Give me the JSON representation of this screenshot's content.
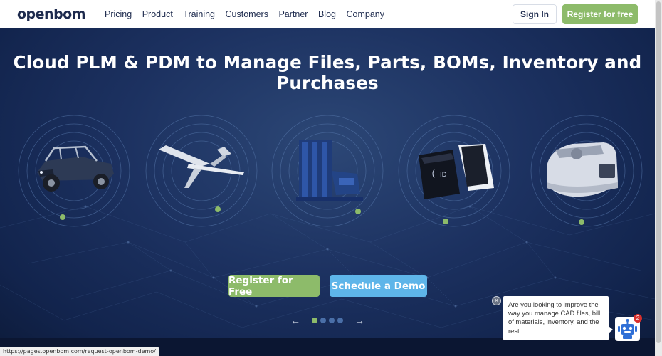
{
  "nav": {
    "logo": "openbom",
    "links": [
      "Pricing",
      "Product",
      "Training",
      "Customers",
      "Partner",
      "Blog",
      "Company"
    ],
    "sign_in": "Sign In",
    "register": "Register for free"
  },
  "hero": {
    "title": "Cloud PLM & PDM to Manage Files, Parts, BOMs, Inventory and Purchases",
    "register_button": "Register for Free",
    "demo_button": "Schedule a Demo",
    "carousel_active_index": 0,
    "carousel_count": 4
  },
  "chat": {
    "message": "Are you looking to improve the way you manage CAD files, bill of materials, inventory, and the rest...",
    "badge": "2"
  },
  "status_url": "https://pages.openbom.com/request-openbom-demo/",
  "colors": {
    "brand_green": "#8dbb6a",
    "demo_blue": "#5eb5e9",
    "navy": "#1d2a4d"
  }
}
